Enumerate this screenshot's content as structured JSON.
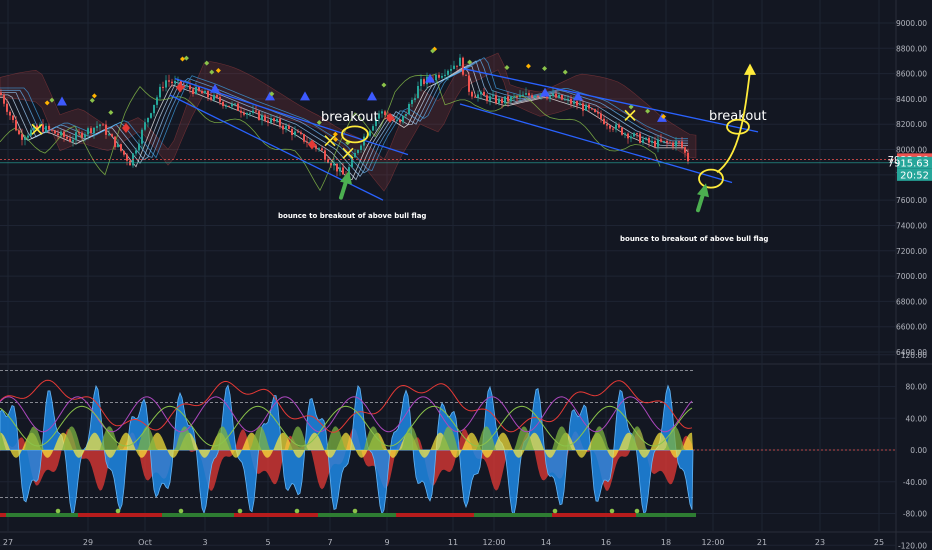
{
  "chart_data": [
    {
      "type": "candlestick",
      "panel": "price",
      "y_ticks": [
        "9000.00",
        "8800.00",
        "8600.00",
        "8400.00",
        "8200.00",
        "8000.00",
        "7800.00",
        "7600.00",
        "7400.00",
        "7200.00",
        "7000.00",
        "6800.00",
        "6600.00",
        "6400.00"
      ],
      "ylim": [
        6300,
        9200
      ],
      "price_labels": [
        {
          "text": "7922.50",
          "value": 7922.5,
          "color": "#ef5350"
        },
        {
          "text": "7915.63",
          "value": 7895,
          "color": "#26a69a"
        },
        {
          "text": "20:52",
          "value": 7800,
          "color": "#26a69a"
        }
      ],
      "annotations": [
        {
          "id": "breakout-1",
          "text": "breakout"
        },
        {
          "id": "breakout-2",
          "text": "breakout"
        },
        {
          "id": "note-1",
          "text": "bounce to breakout of above bull flag"
        },
        {
          "id": "note-2",
          "text": "bounce to breakout of above bull flag"
        }
      ],
      "grid": true
    },
    {
      "type": "area",
      "panel": "oscillator",
      "y_ticks": [
        "120.00",
        "80.00",
        "40.00",
        "0.00",
        "-40.00",
        "-80.00",
        "-120.00"
      ],
      "ylim": [
        -120,
        120
      ],
      "reference_lines": [
        100,
        60,
        0,
        -60
      ],
      "series": [
        {
          "color": "#1e88e5"
        },
        {
          "color": "#e53935"
        },
        {
          "color": "#ffeb3b"
        },
        {
          "color": "#7cb342"
        },
        {
          "color": "#ab47bc"
        }
      ],
      "grid": true
    }
  ],
  "x_axis": {
    "tick_labels": [
      "27",
      "29",
      "Oct",
      "3",
      "5",
      "7",
      "9",
      "11",
      "12:00",
      "14",
      "16",
      "18",
      "12:00",
      "21",
      "23",
      "25"
    ]
  },
  "colors": {
    "background": "#131722",
    "grid": "#1e2433",
    "axis_text": "#b2b5be",
    "candle_up": "#26a69a",
    "candle_down": "#ef5350",
    "channel": "#2962ff",
    "drawing": "#ffeb3b",
    "arrow": "#4caf50"
  }
}
